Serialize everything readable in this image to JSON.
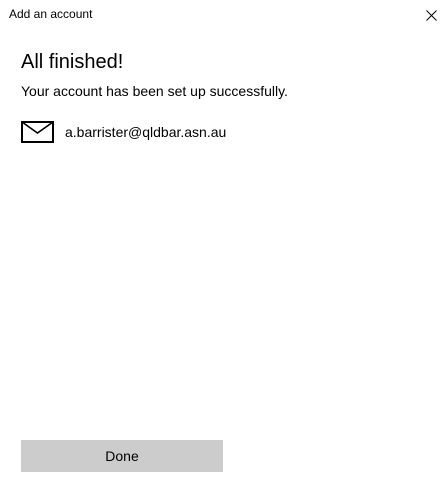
{
  "window": {
    "title": "Add an account",
    "close_icon": "close-icon"
  },
  "main": {
    "heading": "All finished!",
    "message": "Your account has been set up successfully.",
    "account": {
      "icon": "mail-icon",
      "email": "a.barrister@qldbar.asn.au"
    }
  },
  "footer": {
    "done_label": "Done",
    "done_button_color": "#cccccc"
  }
}
